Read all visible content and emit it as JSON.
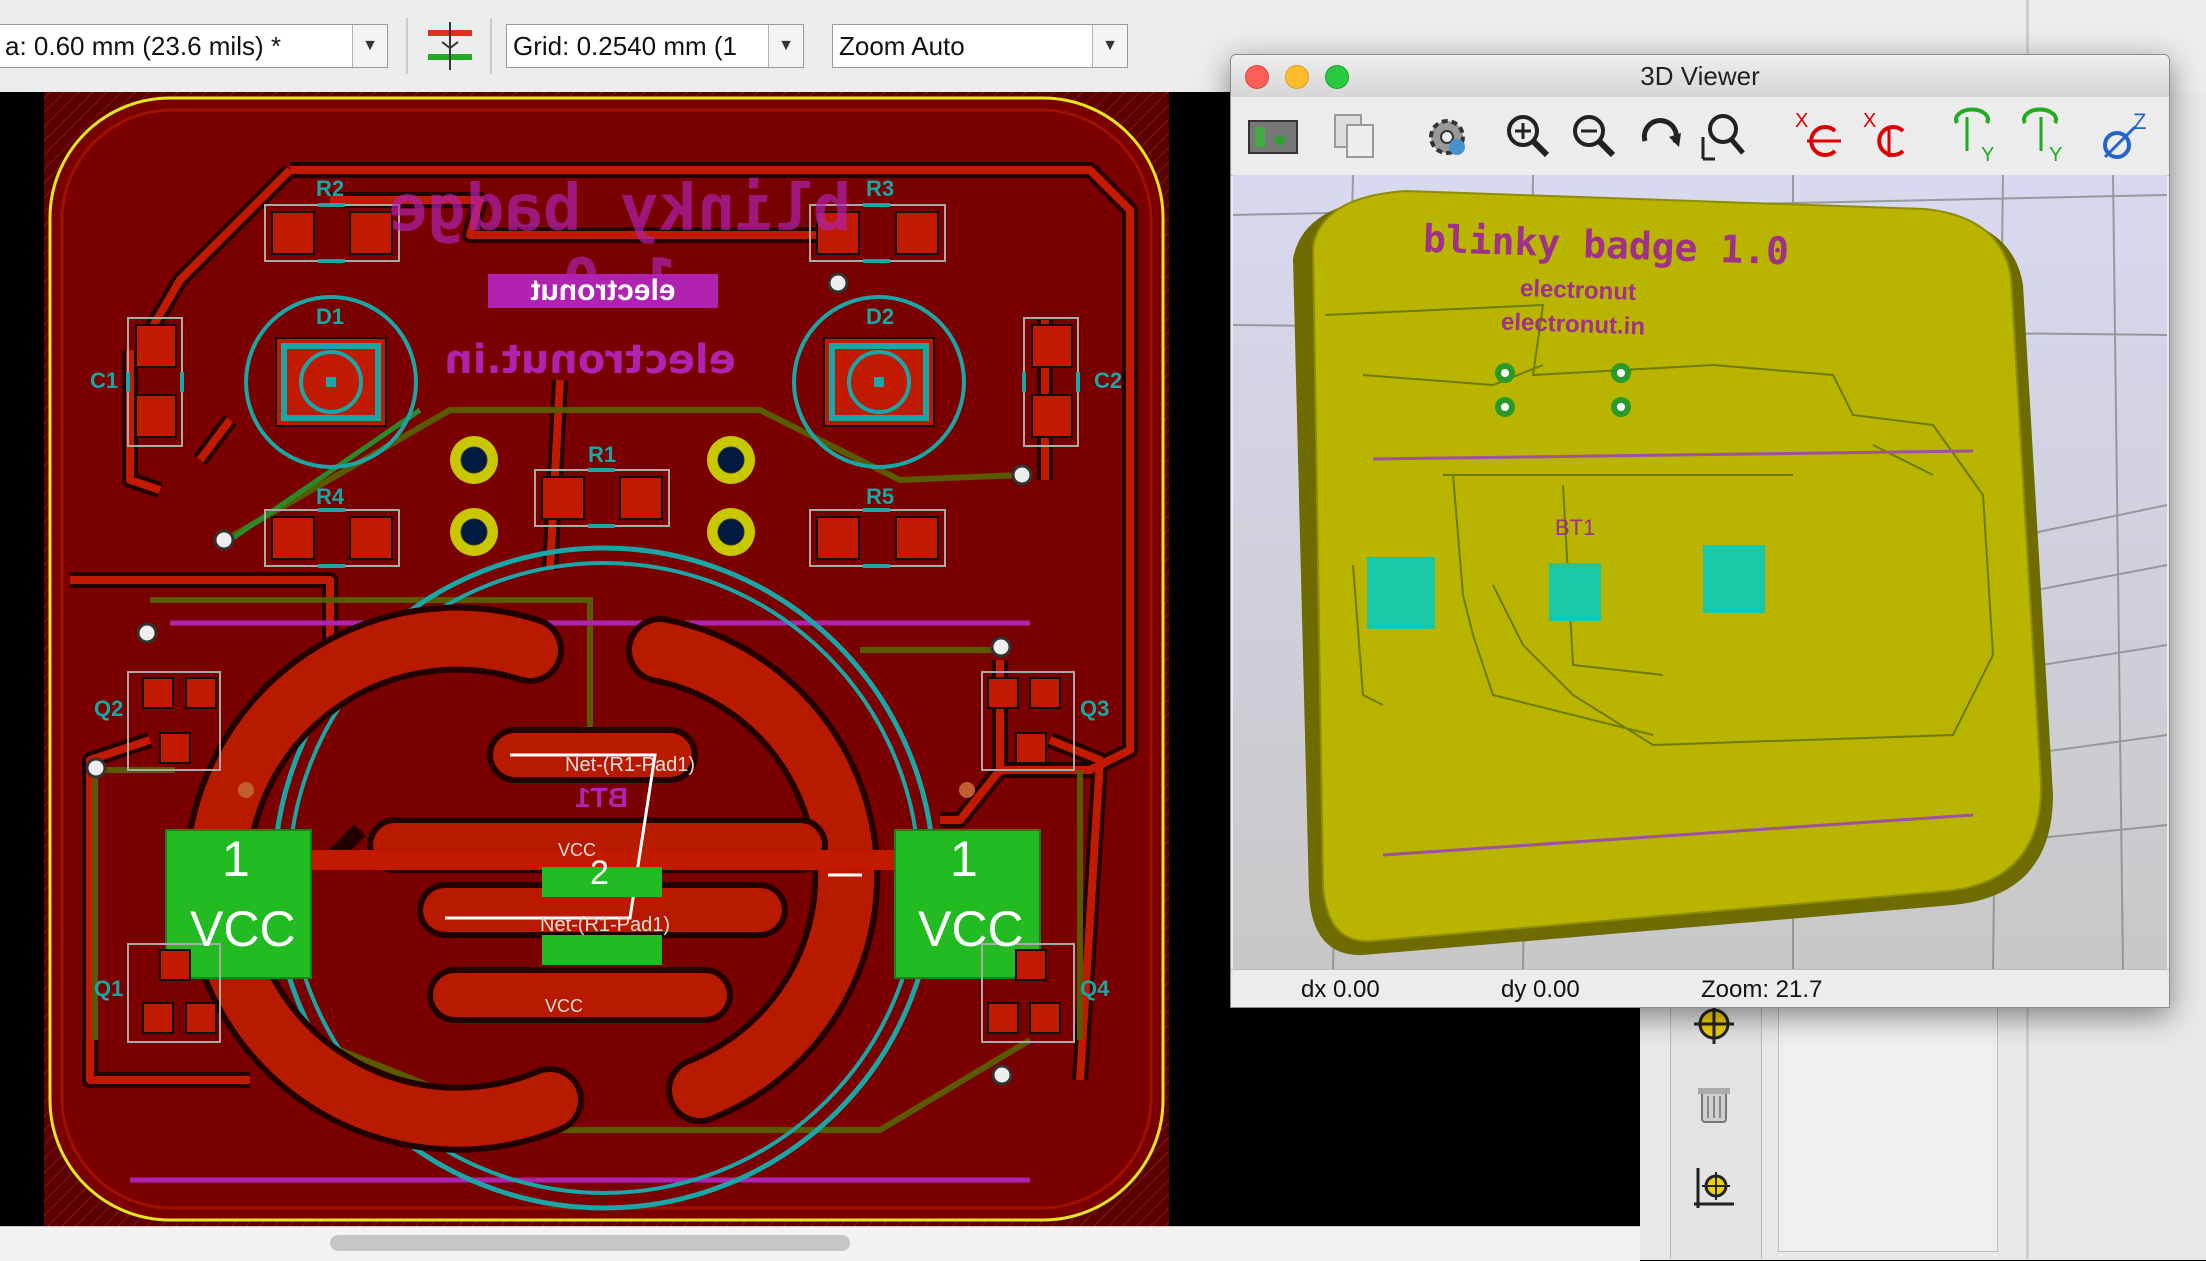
{
  "toolbar": {
    "track_width": "a: 0.60 mm (23.6 mils) *",
    "grid": "Grid: 0.2540 mm (1",
    "zoom": "Zoom Auto"
  },
  "pcb": {
    "silk_title": "blinky badge 1.0",
    "brand": "electronut",
    "website": "electronut.in",
    "refs": {
      "r1": "R1",
      "r2": "R2",
      "r3": "R3",
      "r4": "R4",
      "r5": "R5",
      "d1": "D1",
      "d2": "D2",
      "c1": "C1",
      "c2": "C2",
      "q1": "Q1",
      "q2": "Q2",
      "q3": "Q3",
      "q4": "Q4",
      "bt1": "BT1"
    },
    "pad_one": "1",
    "pad_two": "2",
    "vcc": "VCC",
    "net_label": "Net-(R1-Pad1)"
  },
  "viewer": {
    "title": "3D Viewer",
    "board_title": "blinky badge 1.0",
    "brand": "electronut",
    "website": "electronut.in",
    "bt1": "BT1",
    "axis_x": "X",
    "axis_y": "Y",
    "axis_z": "Z",
    "status": {
      "dx": "dx 0.00",
      "dy": "dy 0.00",
      "zoom": "Zoom: 21.7"
    }
  },
  "colors": {
    "board_fill": "#7a0000",
    "copper": "#c21a00",
    "silk_cyan": "#1aa6a6",
    "silk_magenta": "#b022b0",
    "edge_yellow": "#e6e61a",
    "pad_green": "#22bb22",
    "board3d": "#b8b400",
    "pad3d": "#18c8a6"
  }
}
